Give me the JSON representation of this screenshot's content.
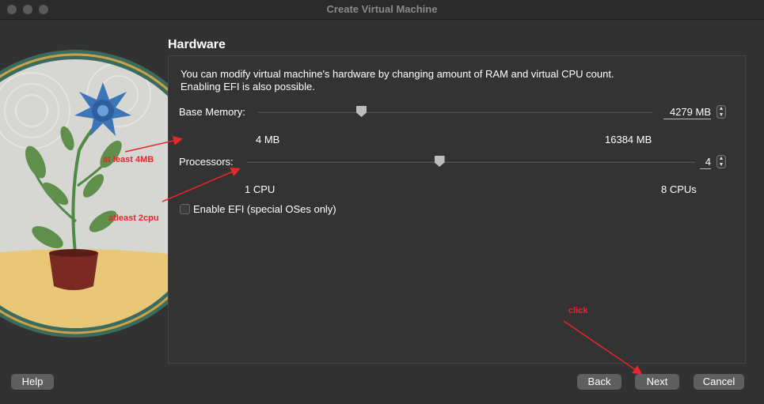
{
  "window": {
    "title": "Create Virtual Machine"
  },
  "page": {
    "heading": "Hardware",
    "description_line1": "You can modify virtual machine's hardware by changing amount of RAM and virtual CPU count.",
    "description_line2": "Enabling EFI is also possible."
  },
  "memory": {
    "label": "Base Memory:",
    "value": "4279 MB",
    "min_label": "4 MB",
    "max_label": "16384 MB",
    "min": 4,
    "max": 16384,
    "current": 4279
  },
  "processors": {
    "label": "Processors:",
    "value": "4",
    "min_label": "1 CPU",
    "max_label": "8 CPUs",
    "min": 1,
    "max": 8,
    "current": 4
  },
  "efi": {
    "label": "Enable EFI (special OSes only)",
    "checked": false
  },
  "annotations": {
    "memory_note": "at least 4MB",
    "cpu_note": "atleast 2cpu",
    "click_note": "click",
    "color": "#e8262c"
  },
  "buttons": {
    "help": "Help",
    "back": "Back",
    "next": "Next",
    "cancel": "Cancel"
  },
  "icons": {
    "spin_up": "chevron-up-icon",
    "spin_down": "chevron-down-icon"
  }
}
